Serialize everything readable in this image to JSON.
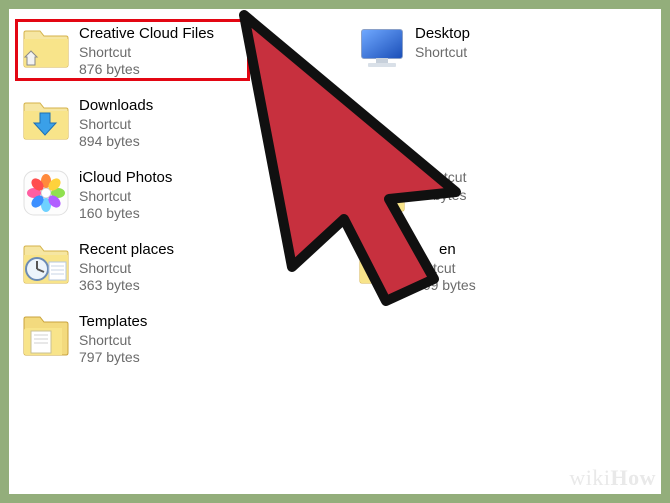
{
  "items": {
    "creative_cloud": {
      "name": "Creative Cloud Files",
      "type": "Shortcut",
      "size": "876 bytes"
    },
    "downloads": {
      "name": "Downloads",
      "type": "Shortcut",
      "size": "894 bytes"
    },
    "icloud_photos": {
      "name": "iCloud Photos",
      "type": "Shortcut",
      "size": "160 bytes"
    },
    "recent_places": {
      "name": "Recent places",
      "type": "Shortcut",
      "size": "363 bytes"
    },
    "templates": {
      "name": "Templates",
      "type": "Shortcut",
      "size": "797 bytes"
    },
    "desktop": {
      "name": "Desktop",
      "type": "Shortcut",
      "size": ""
    },
    "partial_a": {
      "name": "",
      "type": "tcut",
      "size": "bytes"
    },
    "partial_b": {
      "name": "en",
      "type": "tcut",
      "size": "909 bytes"
    }
  },
  "watermark": "wikiHow"
}
